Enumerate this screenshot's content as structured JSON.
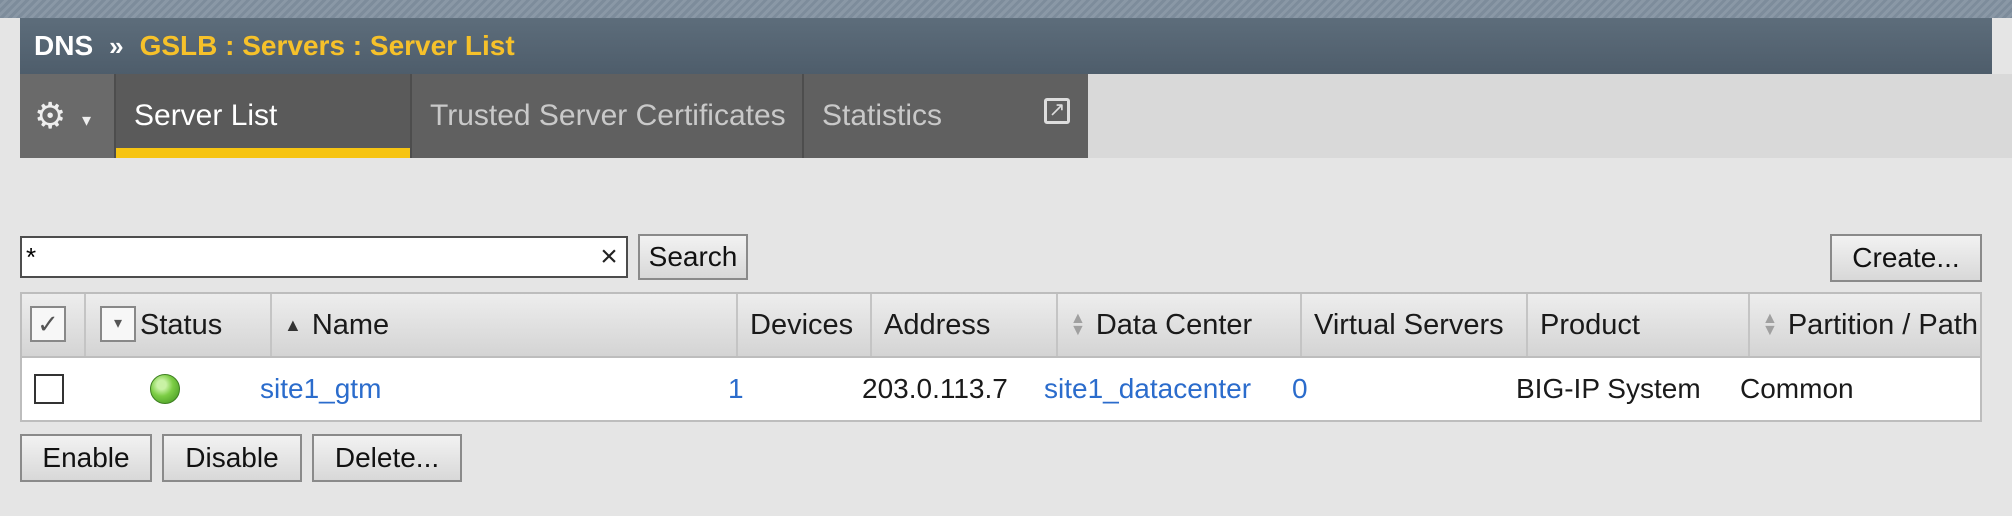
{
  "breadcrumb": {
    "root": "DNS",
    "separator": "»",
    "path": "GSLB : Servers : Server List"
  },
  "tabs": {
    "gear_icon": "gear-icon",
    "items": [
      {
        "label": "Server List",
        "active": true
      },
      {
        "label": "Trusted Server Certificates",
        "active": false
      },
      {
        "label": "Statistics",
        "active": false,
        "icon": "external-link-icon"
      }
    ]
  },
  "search": {
    "value": "*",
    "clear_glyph": "×",
    "button_label": "Search"
  },
  "create_label": "Create...",
  "table": {
    "columns": [
      "Status",
      "Name",
      "Devices",
      "Address",
      "Data Center",
      "Virtual Servers",
      "Product",
      "Partition / Path"
    ],
    "rows": [
      {
        "name": "site1_gtm",
        "devices": "1",
        "address": "203.0.113.7",
        "data_center": "site1_datacenter",
        "virtual_servers": "0",
        "product": "BIG-IP System",
        "partition": "Common",
        "status_color": "#7ccd45"
      }
    ]
  },
  "actions": {
    "enable": "Enable",
    "disable": "Disable",
    "delete": "Delete..."
  },
  "colors": {
    "accent": "#f6c412",
    "breadcrumb_path": "#f6c12a",
    "link": "#2b6ccc"
  }
}
